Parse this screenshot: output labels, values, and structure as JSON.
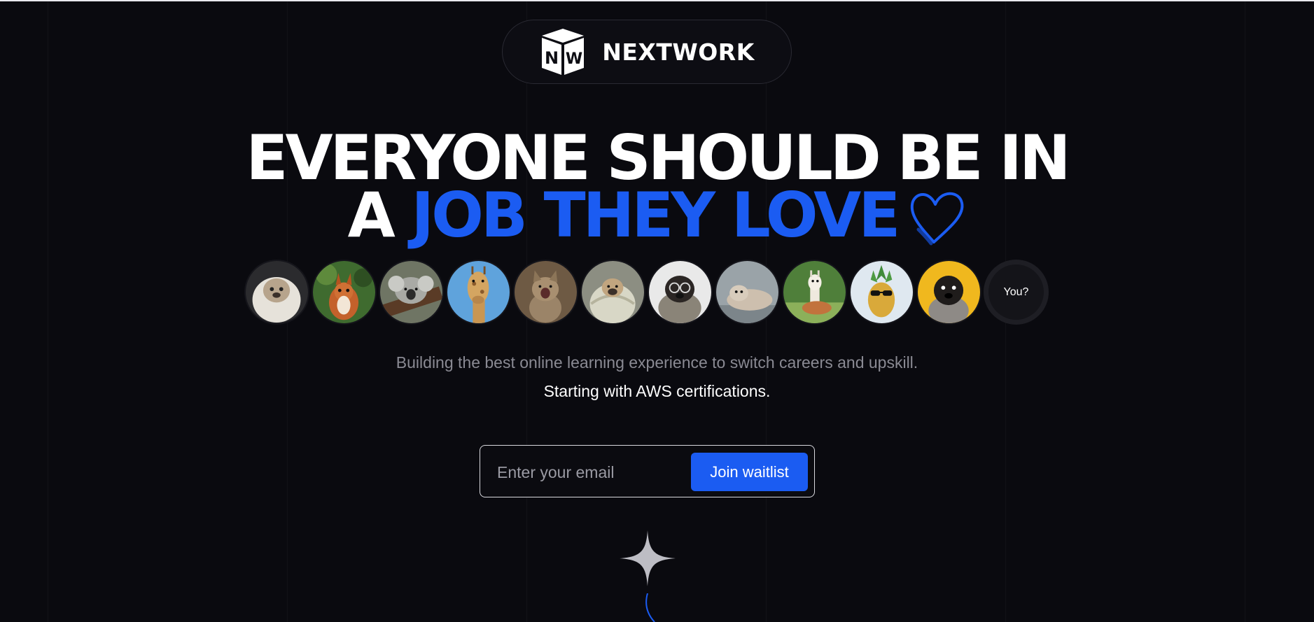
{
  "brand": {
    "name": "NEXTWORK",
    "logo_letters": "NW"
  },
  "headline": {
    "line1": "EVERYONE SHOULD BE IN",
    "line2_prefix": "A",
    "line2_accent": "JOB THEY LOVE"
  },
  "avatars": {
    "you_label": "You?"
  },
  "subtitle": {
    "line1": "Building the best online learning experience to switch careers and upskill.",
    "line2": "Starting with AWS certifications."
  },
  "waitlist": {
    "email_placeholder": "Enter your email",
    "email_value": "",
    "button_label": "Join waitlist"
  },
  "colors": {
    "background": "#0a0a0f",
    "accent": "#1b5cf2",
    "muted_text": "#8a8a93"
  },
  "icons": [
    "nextwork-logo-icon",
    "heart-icon",
    "sparkle-icon"
  ]
}
